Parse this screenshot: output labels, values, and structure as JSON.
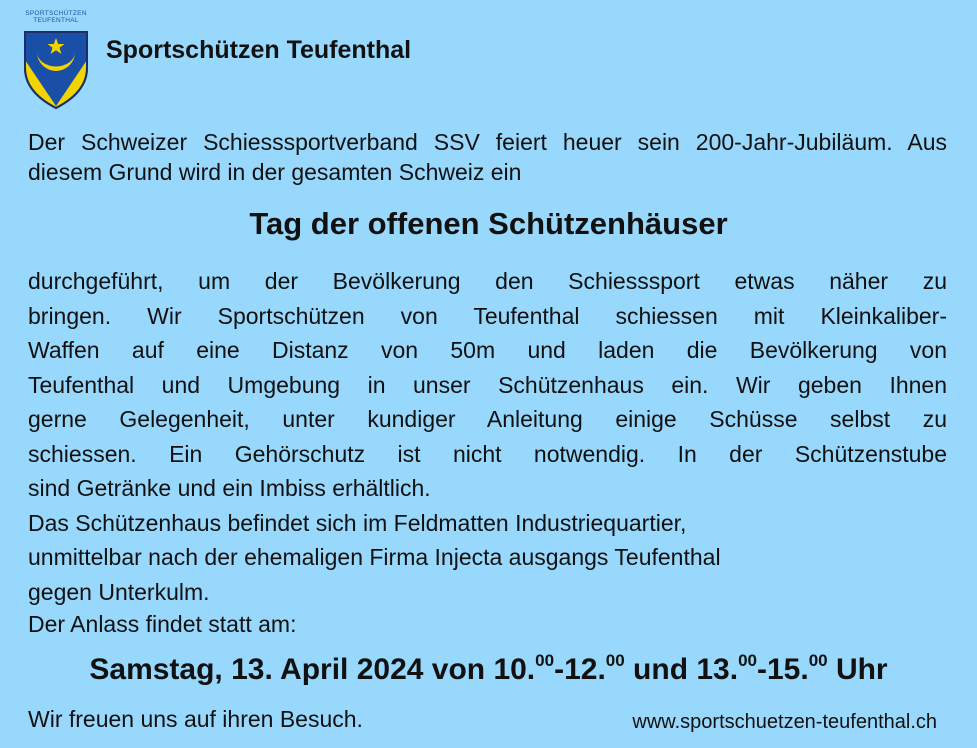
{
  "logo": {
    "line1": "SPORTSCHÜTZEN",
    "line2": "TEUFENTHAL",
    "colors": {
      "shield_blue": "#1a4fa8",
      "shield_yellow": "#f2d400"
    }
  },
  "club_name": "Sportschützen Teufenthal",
  "intro": "Der Schweizer Schiesssportverband SSV feiert heuer sein 200-Jahr-Jubiläum. Aus diesem Grund wird in der gesamten Schweiz ein",
  "headline": "Tag der offenen Schützenhäuser",
  "body": {
    "lines_justified": [
      "durchgeführt, um der Bevölkerung den Schiesssport etwas näher zu",
      "bringen. Wir Sportschützen von Teufenthal schiessen mit Kleinkaliber-",
      "Waffen auf eine Distanz von 50m und laden die Bevölkerung von",
      "Teufenthal und Umgebung in unser Schützenhaus ein. Wir geben Ihnen",
      "gerne Gelegenheit, unter kundiger Anleitung einige Schüsse selbst zu",
      "schiessen. Ein Gehörschutz ist nicht notwendig. In der Schützenstube"
    ],
    "lines_left": [
      "sind Getränke und ein Imbiss erhältlich.",
      "Das Schützenhaus befindet sich im Feldmatten Industriequartier,",
      "unmittelbar nach der ehemaligen Firma Injecta ausgangs Teufenthal",
      "gegen Unterkulm."
    ]
  },
  "date_intro": "Der Anlass findet statt am:",
  "date": {
    "prefix": "Samstag, 13. April 2024 von 10.",
    "sup1": "00",
    "mid1": "-12.",
    "sup2": "00",
    "mid2": " und 13.",
    "sup3": "00",
    "mid3": "-15.",
    "sup4": "00",
    "suffix": " Uhr"
  },
  "farewell": "Wir freuen uns auf ihren Besuch.",
  "website": "www.sportschuetzen-teufenthal.ch"
}
